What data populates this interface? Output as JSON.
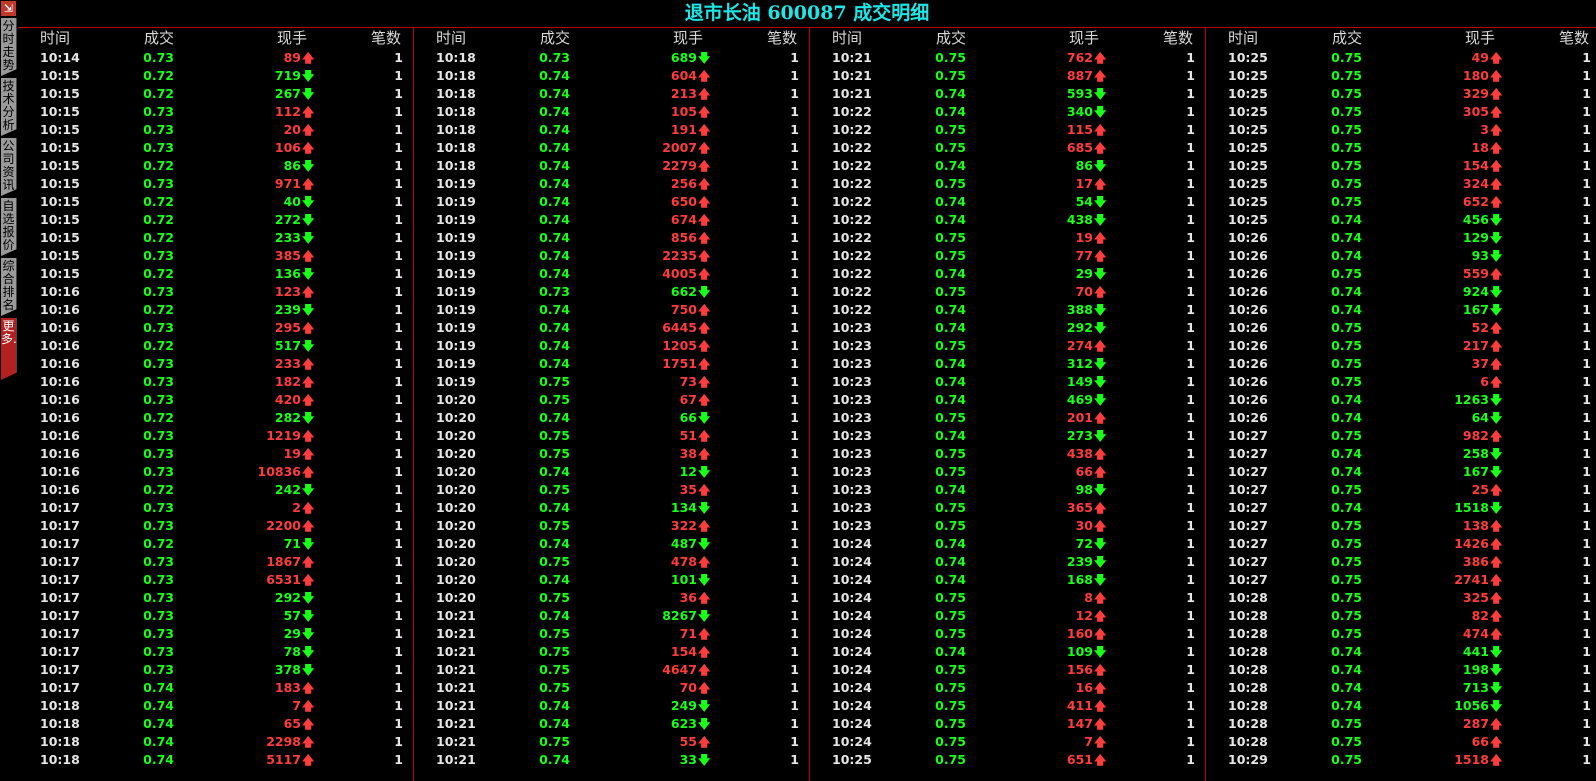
{
  "title": "退市长油 600087 成交明细",
  "colors": {
    "up": "#ff3d3d",
    "down": "#1aff1a",
    "title": "#1ee6e6",
    "grid": "#c00000"
  },
  "sidebar": {
    "exit_icon": "exit-icon",
    "tabs": [
      "分时走势",
      "技术分析",
      "公司资讯",
      "自选报价",
      "综合排名",
      "更多..."
    ]
  },
  "headers": {
    "time": "时间",
    "price": "成交",
    "volume": "现手",
    "count": "笔数"
  },
  "columns": [
    {
      "rows": [
        [
          "10:14",
          "0.73",
          89,
          "up",
          1
        ],
        [
          "10:15",
          "0.72",
          719,
          "down",
          1
        ],
        [
          "10:15",
          "0.72",
          267,
          "down",
          1
        ],
        [
          "10:15",
          "0.73",
          112,
          "up",
          1
        ],
        [
          "10:15",
          "0.73",
          20,
          "up",
          1
        ],
        [
          "10:15",
          "0.73",
          106,
          "up",
          1
        ],
        [
          "10:15",
          "0.72",
          86,
          "down",
          1
        ],
        [
          "10:15",
          "0.73",
          971,
          "up",
          1
        ],
        [
          "10:15",
          "0.72",
          40,
          "down",
          1
        ],
        [
          "10:15",
          "0.72",
          272,
          "down",
          1
        ],
        [
          "10:15",
          "0.72",
          233,
          "down",
          1
        ],
        [
          "10:15",
          "0.73",
          385,
          "up",
          1
        ],
        [
          "10:15",
          "0.72",
          136,
          "down",
          1
        ],
        [
          "10:16",
          "0.73",
          123,
          "up",
          1
        ],
        [
          "10:16",
          "0.72",
          239,
          "down",
          1
        ],
        [
          "10:16",
          "0.73",
          295,
          "up",
          1
        ],
        [
          "10:16",
          "0.72",
          517,
          "down",
          1
        ],
        [
          "10:16",
          "0.73",
          233,
          "up",
          1
        ],
        [
          "10:16",
          "0.73",
          182,
          "up",
          1
        ],
        [
          "10:16",
          "0.73",
          420,
          "up",
          1
        ],
        [
          "10:16",
          "0.72",
          282,
          "down",
          1
        ],
        [
          "10:16",
          "0.73",
          1219,
          "up",
          1
        ],
        [
          "10:16",
          "0.73",
          19,
          "up",
          1
        ],
        [
          "10:16",
          "0.73",
          10836,
          "up",
          1
        ],
        [
          "10:16",
          "0.72",
          242,
          "down",
          1
        ],
        [
          "10:17",
          "0.73",
          2,
          "up",
          1
        ],
        [
          "10:17",
          "0.73",
          2200,
          "up",
          1
        ],
        [
          "10:17",
          "0.72",
          71,
          "down",
          1
        ],
        [
          "10:17",
          "0.73",
          1867,
          "up",
          1
        ],
        [
          "10:17",
          "0.73",
          6531,
          "up",
          1
        ],
        [
          "10:17",
          "0.73",
          292,
          "down",
          1
        ],
        [
          "10:17",
          "0.73",
          57,
          "down",
          1
        ],
        [
          "10:17",
          "0.73",
          29,
          "down",
          1
        ],
        [
          "10:17",
          "0.73",
          78,
          "down",
          1
        ],
        [
          "10:17",
          "0.73",
          378,
          "down",
          1
        ],
        [
          "10:17",
          "0.74",
          183,
          "up",
          1
        ],
        [
          "10:18",
          "0.74",
          7,
          "up",
          1
        ],
        [
          "10:18",
          "0.74",
          65,
          "up",
          1
        ],
        [
          "10:18",
          "0.74",
          2298,
          "up",
          1
        ],
        [
          "10:18",
          "0.74",
          5117,
          "up",
          1
        ]
      ]
    },
    {
      "rows": [
        [
          "10:18",
          "0.73",
          689,
          "down",
          1
        ],
        [
          "10:18",
          "0.74",
          604,
          "up",
          1
        ],
        [
          "10:18",
          "0.74",
          213,
          "up",
          1
        ],
        [
          "10:18",
          "0.74",
          105,
          "up",
          1
        ],
        [
          "10:18",
          "0.74",
          191,
          "up",
          1
        ],
        [
          "10:18",
          "0.74",
          2007,
          "up",
          1
        ],
        [
          "10:18",
          "0.74",
          2279,
          "up",
          1
        ],
        [
          "10:19",
          "0.74",
          256,
          "up",
          1
        ],
        [
          "10:19",
          "0.74",
          650,
          "up",
          1
        ],
        [
          "10:19",
          "0.74",
          674,
          "up",
          1
        ],
        [
          "10:19",
          "0.74",
          856,
          "up",
          1
        ],
        [
          "10:19",
          "0.74",
          2235,
          "up",
          1
        ],
        [
          "10:19",
          "0.74",
          4005,
          "up",
          1
        ],
        [
          "10:19",
          "0.73",
          662,
          "down",
          1
        ],
        [
          "10:19",
          "0.74",
          750,
          "up",
          1
        ],
        [
          "10:19",
          "0.74",
          6445,
          "up",
          1
        ],
        [
          "10:19",
          "0.74",
          1205,
          "up",
          1
        ],
        [
          "10:19",
          "0.74",
          1751,
          "up",
          1
        ],
        [
          "10:19",
          "0.75",
          73,
          "up",
          1
        ],
        [
          "10:20",
          "0.75",
          67,
          "up",
          1
        ],
        [
          "10:20",
          "0.74",
          66,
          "down",
          1
        ],
        [
          "10:20",
          "0.75",
          51,
          "up",
          1
        ],
        [
          "10:20",
          "0.75",
          38,
          "up",
          1
        ],
        [
          "10:20",
          "0.74",
          12,
          "down",
          1
        ],
        [
          "10:20",
          "0.75",
          35,
          "up",
          1
        ],
        [
          "10:20",
          "0.74",
          134,
          "down",
          1
        ],
        [
          "10:20",
          "0.75",
          322,
          "up",
          1
        ],
        [
          "10:20",
          "0.74",
          487,
          "down",
          1
        ],
        [
          "10:20",
          "0.75",
          478,
          "up",
          1
        ],
        [
          "10:20",
          "0.74",
          101,
          "down",
          1
        ],
        [
          "10:20",
          "0.75",
          36,
          "up",
          1
        ],
        [
          "10:21",
          "0.74",
          8267,
          "down",
          1
        ],
        [
          "10:21",
          "0.75",
          71,
          "up",
          1
        ],
        [
          "10:21",
          "0.75",
          154,
          "up",
          1
        ],
        [
          "10:21",
          "0.75",
          4647,
          "up",
          1
        ],
        [
          "10:21",
          "0.75",
          70,
          "up",
          1
        ],
        [
          "10:21",
          "0.74",
          249,
          "down",
          1
        ],
        [
          "10:21",
          "0.74",
          623,
          "down",
          1
        ],
        [
          "10:21",
          "0.75",
          55,
          "up",
          1
        ],
        [
          "10:21",
          "0.74",
          33,
          "down",
          1
        ]
      ]
    },
    {
      "rows": [
        [
          "10:21",
          "0.75",
          762,
          "up",
          1
        ],
        [
          "10:21",
          "0.75",
          887,
          "up",
          1
        ],
        [
          "10:21",
          "0.74",
          593,
          "down",
          1
        ],
        [
          "10:22",
          "0.74",
          340,
          "down",
          1
        ],
        [
          "10:22",
          "0.75",
          115,
          "up",
          1
        ],
        [
          "10:22",
          "0.75",
          685,
          "up",
          1
        ],
        [
          "10:22",
          "0.74",
          86,
          "down",
          1
        ],
        [
          "10:22",
          "0.75",
          17,
          "up",
          1
        ],
        [
          "10:22",
          "0.74",
          54,
          "down",
          1
        ],
        [
          "10:22",
          "0.74",
          438,
          "down",
          1
        ],
        [
          "10:22",
          "0.75",
          19,
          "up",
          1
        ],
        [
          "10:22",
          "0.75",
          77,
          "up",
          1
        ],
        [
          "10:22",
          "0.74",
          29,
          "down",
          1
        ],
        [
          "10:22",
          "0.75",
          70,
          "up",
          1
        ],
        [
          "10:22",
          "0.74",
          388,
          "down",
          1
        ],
        [
          "10:23",
          "0.74",
          292,
          "down",
          1
        ],
        [
          "10:23",
          "0.75",
          274,
          "up",
          1
        ],
        [
          "10:23",
          "0.74",
          312,
          "down",
          1
        ],
        [
          "10:23",
          "0.74",
          149,
          "down",
          1
        ],
        [
          "10:23",
          "0.74",
          469,
          "down",
          1
        ],
        [
          "10:23",
          "0.75",
          201,
          "up",
          1
        ],
        [
          "10:23",
          "0.74",
          273,
          "down",
          1
        ],
        [
          "10:23",
          "0.75",
          438,
          "up",
          1
        ],
        [
          "10:23",
          "0.75",
          66,
          "up",
          1
        ],
        [
          "10:23",
          "0.74",
          98,
          "down",
          1
        ],
        [
          "10:23",
          "0.75",
          365,
          "up",
          1
        ],
        [
          "10:23",
          "0.75",
          30,
          "up",
          1
        ],
        [
          "10:24",
          "0.74",
          72,
          "down",
          1
        ],
        [
          "10:24",
          "0.74",
          239,
          "down",
          1
        ],
        [
          "10:24",
          "0.74",
          168,
          "down",
          1
        ],
        [
          "10:24",
          "0.75",
          8,
          "up",
          1
        ],
        [
          "10:24",
          "0.75",
          12,
          "up",
          1
        ],
        [
          "10:24",
          "0.75",
          160,
          "up",
          1
        ],
        [
          "10:24",
          "0.74",
          109,
          "down",
          1
        ],
        [
          "10:24",
          "0.75",
          156,
          "up",
          1
        ],
        [
          "10:24",
          "0.75",
          16,
          "up",
          1
        ],
        [
          "10:24",
          "0.75",
          411,
          "up",
          1
        ],
        [
          "10:24",
          "0.75",
          147,
          "up",
          1
        ],
        [
          "10:24",
          "0.75",
          7,
          "up",
          1
        ],
        [
          "10:25",
          "0.75",
          651,
          "up",
          1
        ]
      ]
    },
    {
      "rows": [
        [
          "10:25",
          "0.75",
          49,
          "up",
          1
        ],
        [
          "10:25",
          "0.75",
          180,
          "up",
          1
        ],
        [
          "10:25",
          "0.75",
          329,
          "up",
          1
        ],
        [
          "10:25",
          "0.75",
          305,
          "up",
          1
        ],
        [
          "10:25",
          "0.75",
          3,
          "up",
          1
        ],
        [
          "10:25",
          "0.75",
          18,
          "up",
          1
        ],
        [
          "10:25",
          "0.75",
          154,
          "up",
          1
        ],
        [
          "10:25",
          "0.75",
          324,
          "up",
          1
        ],
        [
          "10:25",
          "0.75",
          652,
          "up",
          1
        ],
        [
          "10:25",
          "0.74",
          456,
          "down",
          1
        ],
        [
          "10:26",
          "0.74",
          129,
          "down",
          1
        ],
        [
          "10:26",
          "0.74",
          93,
          "down",
          1
        ],
        [
          "10:26",
          "0.75",
          559,
          "up",
          1
        ],
        [
          "10:26",
          "0.74",
          924,
          "down",
          1
        ],
        [
          "10:26",
          "0.74",
          167,
          "down",
          1
        ],
        [
          "10:26",
          "0.75",
          52,
          "up",
          1
        ],
        [
          "10:26",
          "0.75",
          217,
          "up",
          1
        ],
        [
          "10:26",
          "0.75",
          37,
          "up",
          1
        ],
        [
          "10:26",
          "0.75",
          6,
          "up",
          1
        ],
        [
          "10:26",
          "0.74",
          1263,
          "down",
          1
        ],
        [
          "10:26",
          "0.74",
          64,
          "down",
          1
        ],
        [
          "10:27",
          "0.75",
          982,
          "up",
          1
        ],
        [
          "10:27",
          "0.74",
          258,
          "down",
          1
        ],
        [
          "10:27",
          "0.74",
          167,
          "down",
          1
        ],
        [
          "10:27",
          "0.75",
          25,
          "up",
          1
        ],
        [
          "10:27",
          "0.74",
          1518,
          "down",
          1
        ],
        [
          "10:27",
          "0.75",
          138,
          "up",
          1
        ],
        [
          "10:27",
          "0.75",
          1426,
          "up",
          1
        ],
        [
          "10:27",
          "0.75",
          386,
          "up",
          1
        ],
        [
          "10:27",
          "0.75",
          2741,
          "up",
          1
        ],
        [
          "10:28",
          "0.75",
          325,
          "up",
          1
        ],
        [
          "10:28",
          "0.75",
          82,
          "up",
          1
        ],
        [
          "10:28",
          "0.75",
          474,
          "up",
          1
        ],
        [
          "10:28",
          "0.74",
          441,
          "down",
          1
        ],
        [
          "10:28",
          "0.74",
          198,
          "down",
          1
        ],
        [
          "10:28",
          "0.74",
          713,
          "down",
          1
        ],
        [
          "10:28",
          "0.74",
          1056,
          "down",
          1
        ],
        [
          "10:28",
          "0.75",
          287,
          "up",
          1
        ],
        [
          "10:28",
          "0.75",
          66,
          "up",
          1
        ],
        [
          "10:29",
          "0.75",
          1518,
          "up",
          1
        ]
      ]
    }
  ]
}
